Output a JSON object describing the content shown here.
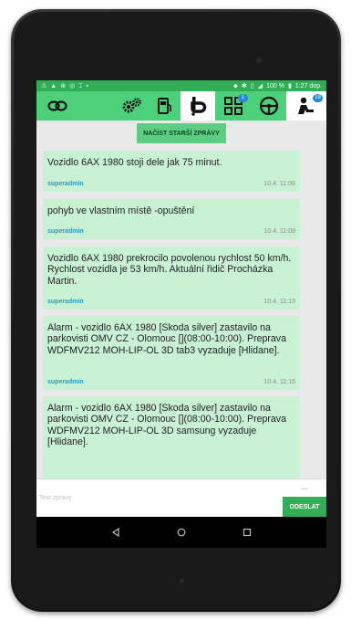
{
  "status_bar": {
    "battery": "100 %",
    "time": "1:27 dop."
  },
  "toolbar": {
    "buttons": [
      {
        "icon": "link-chain-icon"
      },
      {
        "icon": "gears-icon"
      },
      {
        "icon": "fuel-pump-icon"
      },
      {
        "icon": "tacho-icon",
        "active": true
      },
      {
        "icon": "grid-icon",
        "badge": "1"
      },
      {
        "icon": "steering-wheel-icon"
      },
      {
        "icon": "driver-icon",
        "badge": "18"
      }
    ]
  },
  "chat": {
    "load_older_label": "NAČÍST STARŠÍ ZPRÁVY",
    "messages": [
      {
        "text": "Vozidlo 6AX 1980 stoji dele jak 75 minut.",
        "author": "superadmin",
        "time": "10.4. 11:06"
      },
      {
        "text": "pohyb ve vlastním místě -opuštění",
        "author": "superadmin",
        "time": "10.4. 11:08"
      },
      {
        "text": "Vozidlo 6AX 1980 prekrocilo povolenou rychlost 50 km/h. Rychlost vozidla je 53 km/h. Aktuální řidič Procházka Martin.",
        "author": "superadmin",
        "time": "10.4. 11:13"
      },
      {
        "text": "Alarm - vozidlo 6AX 1980 [Skoda silver] zastavilo na parkovisti OMV CZ - Olomouc [](08:00-10:00). Preprava WDFMV212 MOH-LIP-OL 3D tab3 vyzaduje [Hlidane].",
        "author": "superadmin",
        "time": "10.4. 11:15"
      },
      {
        "text": "Alarm - vozidlo 6AX 1980 [Skoda silver] zastavilo na parkovisti OMV CZ - Olomouc [](08:00-10:00). Preprava WDFMV212 MOH-LIP-OL 3D samsung vyzaduje [Hlidane]."
      }
    ]
  },
  "composer": {
    "placeholder": "Text zprávy",
    "dots": "...",
    "send_label": "ODESLAT"
  },
  "colors": {
    "accent": "#2fae55",
    "toolbar": "#4cd07a",
    "bubble": "#c9f1d4",
    "author": "#2a9bbf"
  }
}
